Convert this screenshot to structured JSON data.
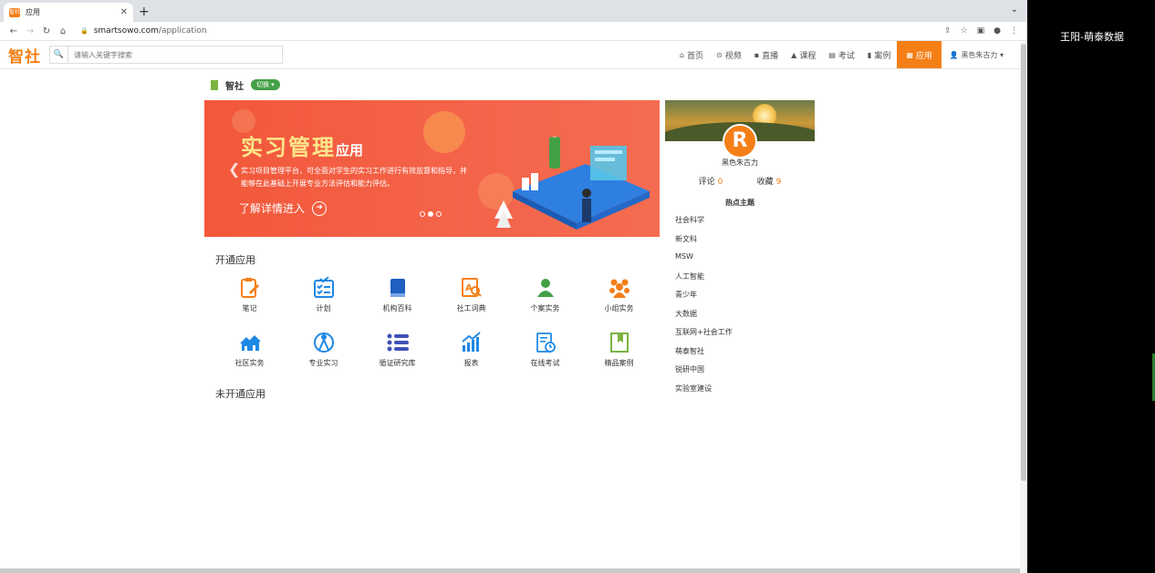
{
  "browser": {
    "tab_title": "应用",
    "tab_favicon": "智社",
    "url_domain": "smartsowo.com",
    "url_path": "/application"
  },
  "site": {
    "logo": "智社",
    "search_placeholder": "请输入关键字搜索",
    "nav": [
      {
        "label": "首页",
        "icon": "home-icon"
      },
      {
        "label": "视频",
        "icon": "play-circle-icon"
      },
      {
        "label": "直播",
        "icon": "camera-icon"
      },
      {
        "label": "课程",
        "icon": "graduation-cap-icon"
      },
      {
        "label": "考试",
        "icon": "document-icon"
      },
      {
        "label": "案例",
        "icon": "bookmark-icon"
      },
      {
        "label": "应用",
        "icon": "grid-icon",
        "active": true
      }
    ],
    "user": "黑色朱古力",
    "accent": "#f57f17"
  },
  "org": {
    "name": "智社",
    "switch_label": "切换"
  },
  "banner": {
    "title": "实习管理",
    "title_sub": "应用",
    "desc": "实习项目管理平台，可全面对学生的实习工作进行有效监督和指导，并能够在此基础上开展专业方法评估和能力评估。",
    "more": "了解详情进入",
    "slide_count": 3,
    "active_slide": 2
  },
  "profile": {
    "avatar_letter": "R",
    "name": "黑色朱古力",
    "comments_label": "评论",
    "comments": "0",
    "favorites_label": "收藏",
    "favorites": "9"
  },
  "hot": {
    "title": "热点主题",
    "items": [
      "社会科学",
      "新文科",
      "MSW",
      "人工智能",
      "青少年",
      "大数据",
      "互联网+社会工作",
      "萌泰智社",
      "锐研中国",
      "实验室建设"
    ]
  },
  "apps": {
    "open_title": "开通应用",
    "closed_title": "未开通应用",
    "items": [
      {
        "label": "笔记",
        "icon": "note-pencil-icon",
        "color": "#f57f17"
      },
      {
        "label": "计划",
        "icon": "checklist-icon",
        "color": "#1e88e5"
      },
      {
        "label": "机构百科",
        "icon": "book-icon",
        "color": "#1e5fbf"
      },
      {
        "label": "社工词典",
        "icon": "dictionary-search-icon",
        "color": "#f57f17"
      },
      {
        "label": "个案实务",
        "icon": "person-icon",
        "color": "#43a047"
      },
      {
        "label": "小组实务",
        "icon": "group-icon",
        "color": "#f57f17"
      },
      {
        "label": "社区实务",
        "icon": "houses-icon",
        "color": "#1e88e5"
      },
      {
        "label": "专业实习",
        "icon": "compass-icon",
        "color": "#1e88e5"
      },
      {
        "label": "循证研究库",
        "icon": "list-icon",
        "color": "#3f51b5"
      },
      {
        "label": "报表",
        "icon": "chart-up-icon",
        "color": "#1e88e5"
      },
      {
        "label": "在线考试",
        "icon": "exam-clock-icon",
        "color": "#1e88e5"
      },
      {
        "label": "精品案例",
        "icon": "bookmark-frame-icon",
        "color": "#7cb342"
      }
    ]
  },
  "side_panel": {
    "label": "王阳-萌泰数据"
  }
}
